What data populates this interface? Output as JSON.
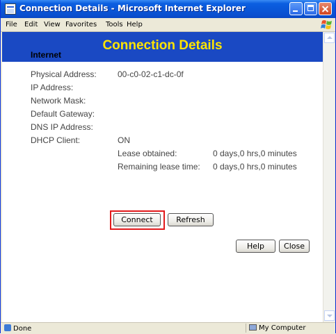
{
  "window": {
    "title": "Connection Details - Microsoft Internet Explorer"
  },
  "menubar": {
    "items": [
      "File",
      "Edit",
      "View",
      "Favorites",
      "Tools",
      "Help"
    ]
  },
  "page": {
    "banner_title": "Connection Details",
    "section_heading": "Internet",
    "fields": [
      {
        "label": "Physical Address:",
        "value": "00-c0-02-c1-dc-0f"
      },
      {
        "label": "IP Address:",
        "value": ""
      },
      {
        "label": "Network Mask:",
        "value": ""
      },
      {
        "label": "Default Gateway:",
        "value": ""
      },
      {
        "label": "DNS IP Address:",
        "value": ""
      },
      {
        "label": "DHCP Client:",
        "value": "ON"
      }
    ],
    "lease": [
      {
        "label": "Lease obtained:",
        "value": "0 days,0 hrs,0 minutes"
      },
      {
        "label": "Remaining lease time:",
        "value": "0 days,0 hrs,0 minutes"
      }
    ],
    "buttons": {
      "connect": "Connect",
      "refresh": "Refresh",
      "help": "Help",
      "close": "Close"
    }
  },
  "statusbar": {
    "left": "Done",
    "right": "My Computer"
  },
  "colors": {
    "banner_bg": "#1a49c3",
    "banner_text": "#ffe400",
    "highlight": "#e2191b"
  }
}
